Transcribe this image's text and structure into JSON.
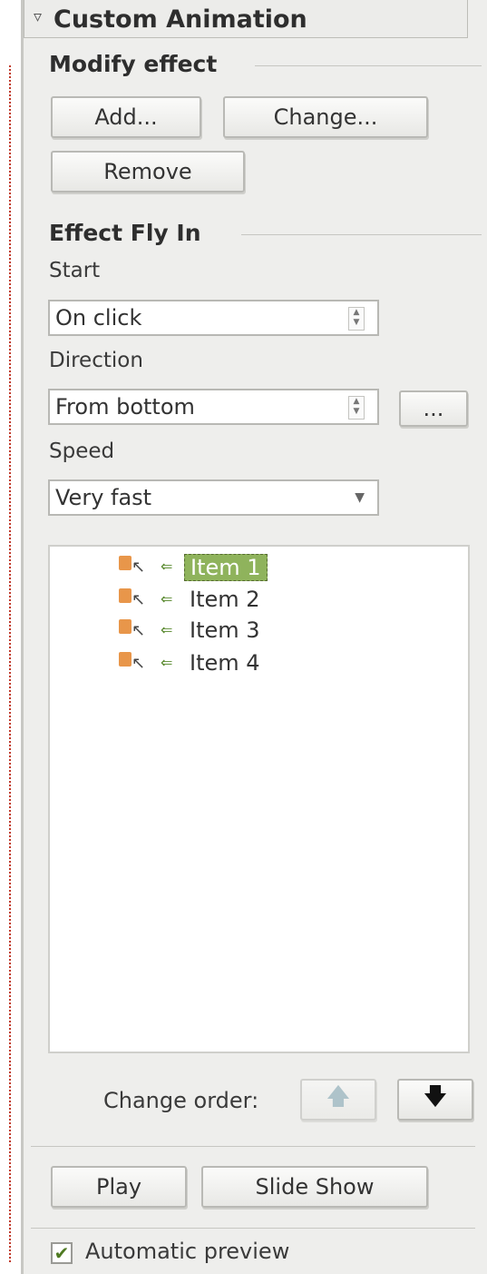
{
  "panel": {
    "title": "Custom Animation",
    "title_icon": "collapse-arrow-icon"
  },
  "modify": {
    "heading": "Modify effect",
    "add_label": "Add...",
    "change_label": "Change...",
    "remove_label": "Remove"
  },
  "effect": {
    "heading": "Effect Fly In",
    "start_label": "Start",
    "start_value": "On click",
    "direction_label": "Direction",
    "direction_value": "From bottom",
    "options_label": "...",
    "speed_label": "Speed",
    "speed_value": "Very fast"
  },
  "list": {
    "items": [
      {
        "label": "Item 1",
        "selected": true
      },
      {
        "label": "Item 2",
        "selected": false
      },
      {
        "label": "Item 3",
        "selected": false
      },
      {
        "label": "Item 4",
        "selected": false
      }
    ]
  },
  "order": {
    "label": "Change order:",
    "up_icon": "arrow-up-icon",
    "down_icon": "arrow-down-icon"
  },
  "playback": {
    "play_label": "Play",
    "slideshow_label": "Slide Show"
  },
  "preview": {
    "label": "Automatic preview",
    "checked": true
  },
  "colors": {
    "selection": "#8fb35c",
    "panel_bg": "#eeeeec",
    "dotted_border": "#c0392b"
  }
}
